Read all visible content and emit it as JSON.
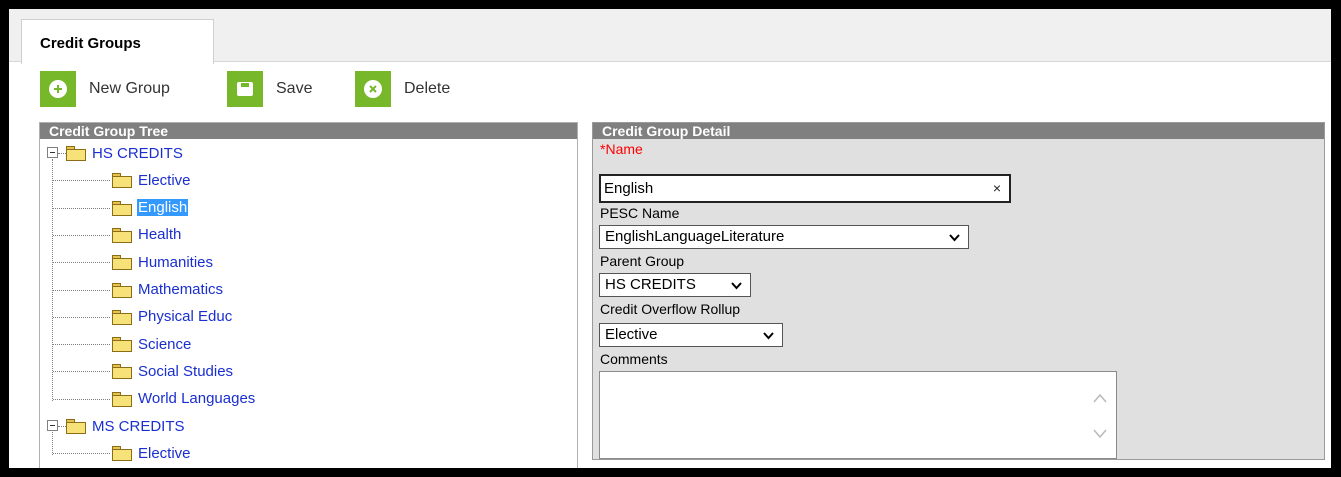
{
  "tab": {
    "label": "Credit Groups"
  },
  "toolbar": {
    "new_label": "New Group",
    "save_label": "Save",
    "delete_label": "Delete"
  },
  "tree_panel": {
    "title": "Credit Group Tree"
  },
  "tree": {
    "groups": [
      {
        "label": "HS CREDITS",
        "children": [
          "Elective",
          "English",
          "Health",
          "Humanities",
          "Mathematics",
          "Physical Educ",
          "Science",
          "Social Studies",
          "World Languages"
        ]
      },
      {
        "label": "MS CREDITS",
        "children": [
          "Elective"
        ]
      }
    ],
    "selected": "English"
  },
  "detail_panel": {
    "title": "Credit Group Detail"
  },
  "form": {
    "name_required_mark": "*",
    "name_label": "Name",
    "name_value": "English",
    "clear_glyph": "×",
    "pesc_label": "PESC Name",
    "pesc_value": "EnglishLanguageLiterature",
    "parent_label": "Parent Group",
    "parent_value": "HS CREDITS",
    "overflow_label": "Credit Overflow Rollup",
    "overflow_value": "Elective",
    "comments_label": "Comments",
    "comments_value": ""
  },
  "colors": {
    "toolbar_icon_bg": "#77b82a",
    "panel_header_bg": "#808080",
    "tree_link": "#1a2fd0",
    "selection_bg": "#3399ff",
    "required": "#ff0000",
    "detail_bg": "#e0e0e0"
  },
  "icons": {
    "new": "plus-circle-icon",
    "save": "save-icon",
    "delete": "x-circle-icon",
    "folder": "folder-icon",
    "expander": "collapse-icon"
  }
}
